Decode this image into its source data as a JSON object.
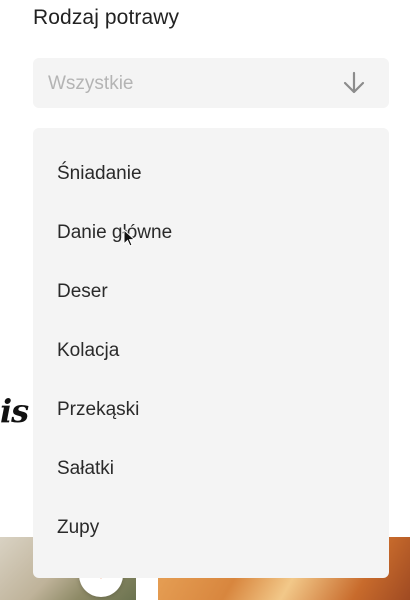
{
  "field": {
    "label": "Rodzaj potrawy",
    "selected_value": "Wszystkie",
    "arrow_icon": "arrow-down-icon"
  },
  "dropdown": {
    "options": [
      "Śniadanie",
      "Danie główne",
      "Deser",
      "Kolacja",
      "Przekąski",
      "Sałatki",
      "Zupy"
    ]
  },
  "background": {
    "partial_text": "is"
  },
  "colors": {
    "field_bg": "#f4f4f4",
    "placeholder": "#b4b4b4",
    "accent": "#e8692b"
  }
}
